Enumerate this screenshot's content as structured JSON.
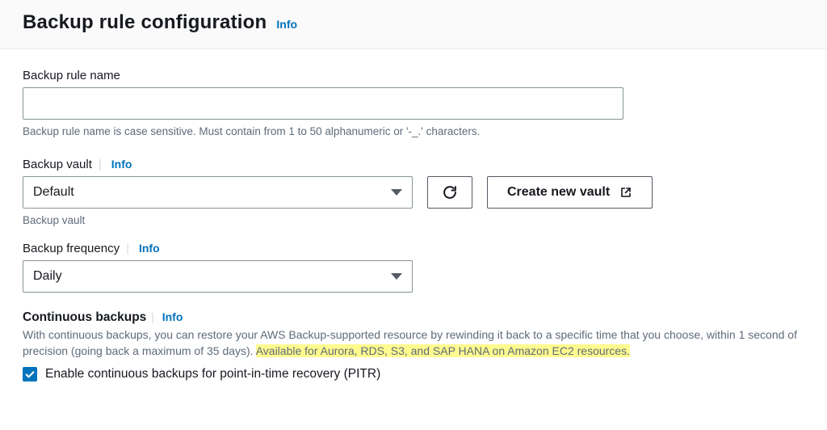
{
  "header": {
    "title": "Backup rule configuration",
    "info": "Info"
  },
  "rule_name": {
    "label": "Backup rule name",
    "value": "",
    "hint": "Backup rule name is case sensitive. Must contain from 1 to 50 alphanumeric or '-_.' characters."
  },
  "vault": {
    "label": "Backup vault",
    "info": "Info",
    "selected": "Default",
    "sub_hint": "Backup vault",
    "create_button": "Create new vault"
  },
  "frequency": {
    "label": "Backup frequency",
    "info": "Info",
    "selected": "Daily"
  },
  "continuous": {
    "label": "Continuous backups",
    "info": "Info",
    "desc_pre": "With continuous backups, you can restore your AWS Backup-supported resource by rewinding it back to a specific time that you choose, within 1 second of precision (going back a maximum of 35 days). ",
    "desc_highlight": "Available for Aurora, RDS, S3, and SAP HANA on Amazon EC2 resources.",
    "checkbox_checked": true,
    "checkbox_label": "Enable continuous backups for point-in-time recovery (PITR)"
  }
}
